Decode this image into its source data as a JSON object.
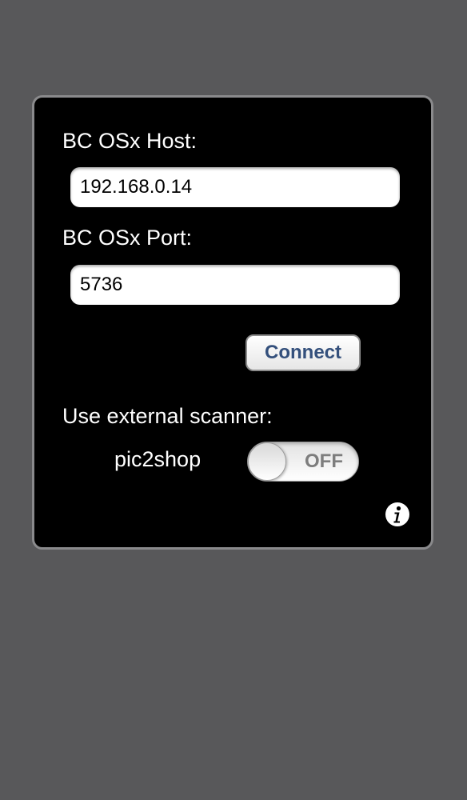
{
  "settings": {
    "host_label": "BC OSx Host:",
    "host_value": "192.168.0.14",
    "port_label": "BC OSx Port:",
    "port_value": "5736",
    "connect_label": "Connect",
    "scanner_label": "Use external scanner:",
    "scanner_name": "pic2shop",
    "scanner_toggle_state": "OFF"
  },
  "icons": {
    "info": "info-icon"
  },
  "colors": {
    "background": "#58585a",
    "panel": "#000000",
    "panel_border": "#8a8a8c",
    "connect_text": "#34507c",
    "toggle_text": "#7d7d7d"
  }
}
